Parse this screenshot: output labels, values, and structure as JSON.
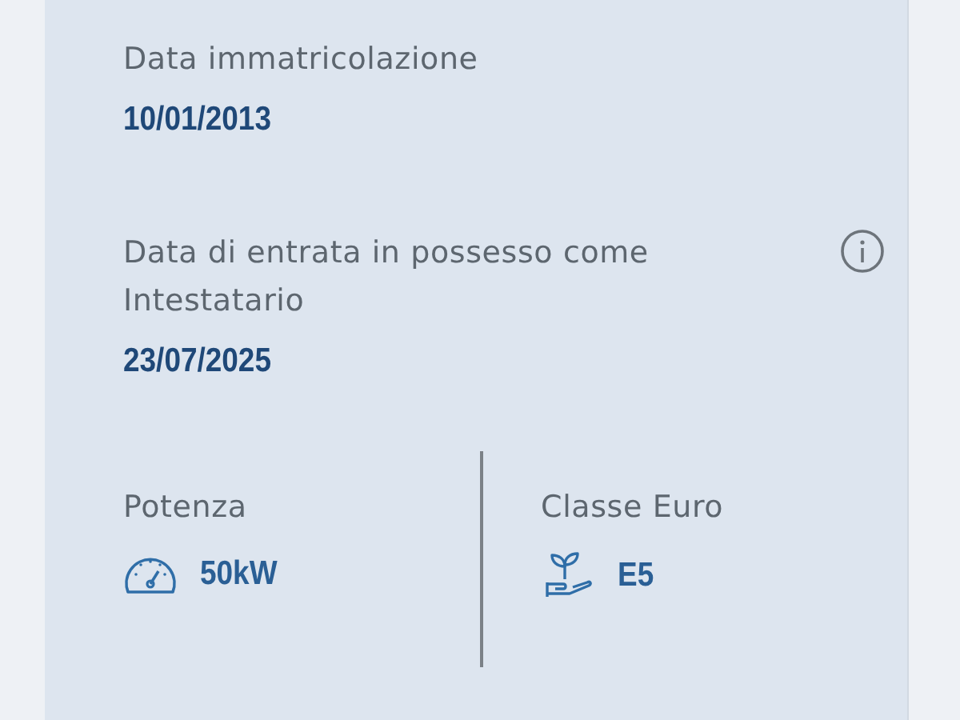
{
  "fields": [
    {
      "label": "Data immatricolazione",
      "value": "10/01/2013",
      "info": false
    },
    {
      "label": "Data di entrata in possesso come Intestatario",
      "value": "23/07/2025",
      "info": true
    }
  ],
  "specs": [
    {
      "label": "Potenza",
      "value": "50kW",
      "kind": "power"
    },
    {
      "label": "Classe Euro",
      "value": "E5",
      "kind": "euro"
    }
  ]
}
